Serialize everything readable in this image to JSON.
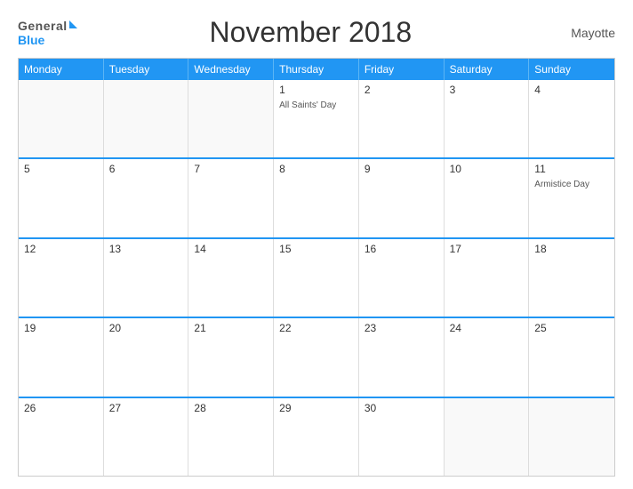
{
  "header": {
    "logo_general": "General",
    "logo_blue": "Blue",
    "title": "November 2018",
    "region": "Mayotte"
  },
  "day_headers": [
    "Monday",
    "Tuesday",
    "Wednesday",
    "Thursday",
    "Friday",
    "Saturday",
    "Sunday"
  ],
  "weeks": [
    [
      {
        "num": "",
        "holiday": ""
      },
      {
        "num": "",
        "holiday": ""
      },
      {
        "num": "",
        "holiday": ""
      },
      {
        "num": "1",
        "holiday": "All Saints' Day"
      },
      {
        "num": "2",
        "holiday": ""
      },
      {
        "num": "3",
        "holiday": ""
      },
      {
        "num": "4",
        "holiday": ""
      }
    ],
    [
      {
        "num": "5",
        "holiday": ""
      },
      {
        "num": "6",
        "holiday": ""
      },
      {
        "num": "7",
        "holiday": ""
      },
      {
        "num": "8",
        "holiday": ""
      },
      {
        "num": "9",
        "holiday": ""
      },
      {
        "num": "10",
        "holiday": ""
      },
      {
        "num": "11",
        "holiday": "Armistice Day"
      }
    ],
    [
      {
        "num": "12",
        "holiday": ""
      },
      {
        "num": "13",
        "holiday": ""
      },
      {
        "num": "14",
        "holiday": ""
      },
      {
        "num": "15",
        "holiday": ""
      },
      {
        "num": "16",
        "holiday": ""
      },
      {
        "num": "17",
        "holiday": ""
      },
      {
        "num": "18",
        "holiday": ""
      }
    ],
    [
      {
        "num": "19",
        "holiday": ""
      },
      {
        "num": "20",
        "holiday": ""
      },
      {
        "num": "21",
        "holiday": ""
      },
      {
        "num": "22",
        "holiday": ""
      },
      {
        "num": "23",
        "holiday": ""
      },
      {
        "num": "24",
        "holiday": ""
      },
      {
        "num": "25",
        "holiday": ""
      }
    ],
    [
      {
        "num": "26",
        "holiday": ""
      },
      {
        "num": "27",
        "holiday": ""
      },
      {
        "num": "28",
        "holiday": ""
      },
      {
        "num": "29",
        "holiday": ""
      },
      {
        "num": "30",
        "holiday": ""
      },
      {
        "num": "",
        "holiday": ""
      },
      {
        "num": "",
        "holiday": ""
      }
    ]
  ]
}
